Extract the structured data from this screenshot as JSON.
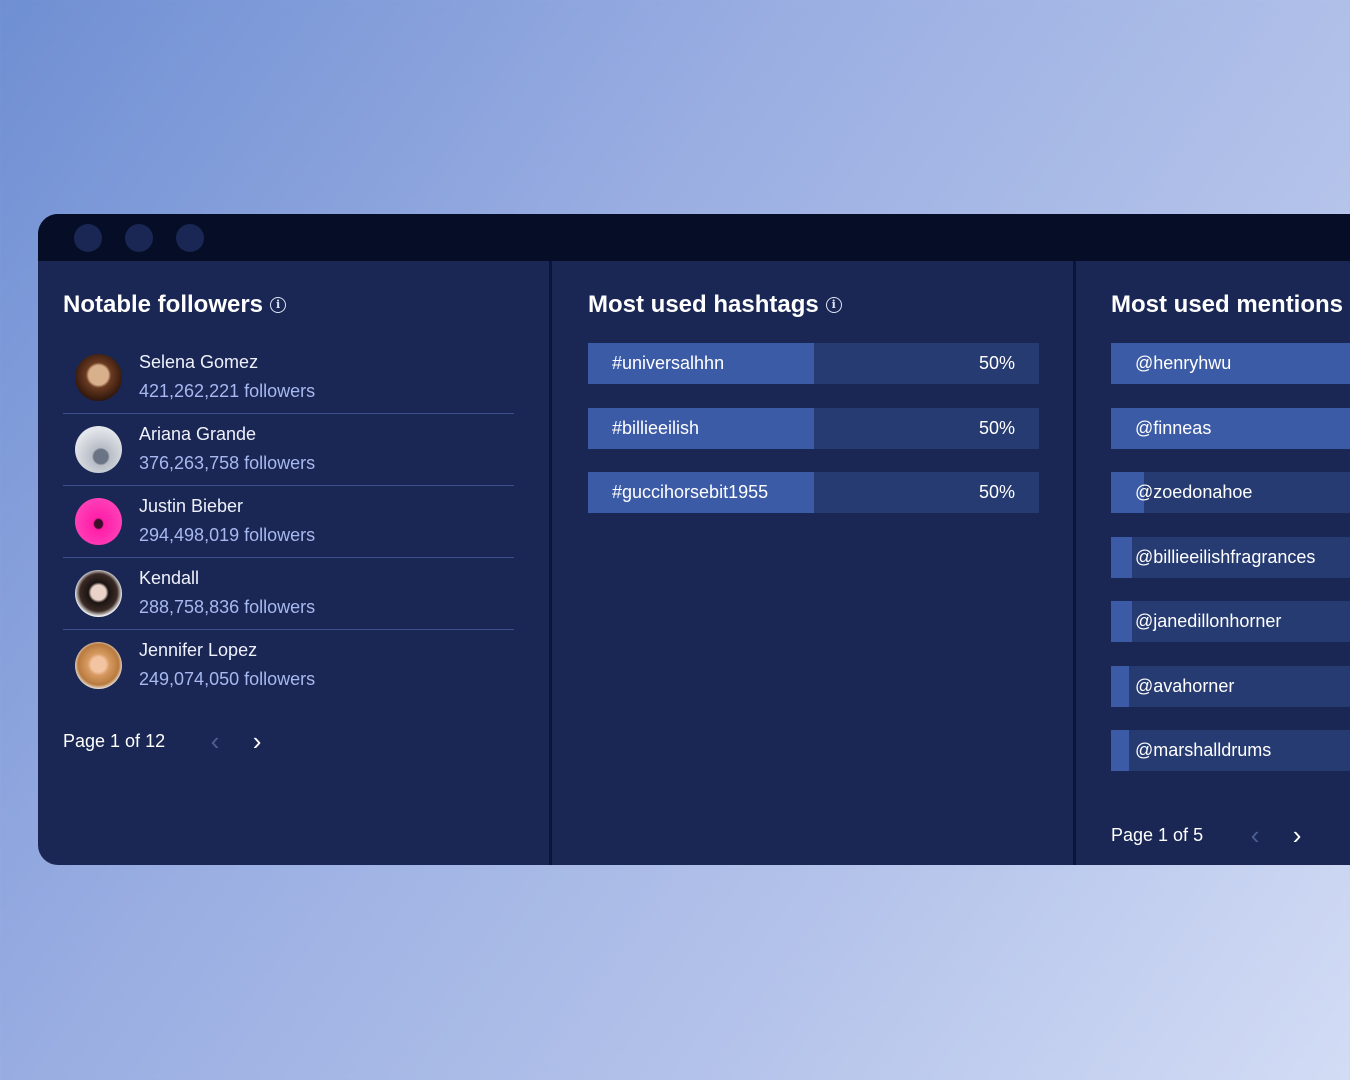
{
  "followers": {
    "title": "Notable followers",
    "items": [
      {
        "name": "Selena Gomez",
        "count": "421,262,221 followers"
      },
      {
        "name": "Ariana Grande",
        "count": "376,263,758 followers"
      },
      {
        "name": "Justin Bieber",
        "count": "294,498,019 followers"
      },
      {
        "name": "Kendall",
        "count": "288,758,836 followers"
      },
      {
        "name": "Jennifer Lopez",
        "count": "249,074,050 followers"
      }
    ],
    "pager": "Page 1 of 12"
  },
  "hashtags": {
    "title": "Most used hashtags",
    "items": [
      {
        "label": "#universalhhn",
        "value": "50%",
        "share": 0.5
      },
      {
        "label": "#billieeilish",
        "value": "50%",
        "share": 0.5
      },
      {
        "label": "#guccihorsebit1955",
        "value": "50%",
        "share": 0.5
      }
    ]
  },
  "mentions": {
    "title": "Most used mentions",
    "items": [
      {
        "label": "@henryhwu",
        "share": 1.0
      },
      {
        "label": "@finneas",
        "share": 1.0
      },
      {
        "label": "@zoedonahoe",
        "share": 0.11
      },
      {
        "label": "@billieeilishfragrances",
        "share": 0.07
      },
      {
        "label": "@janedillonhorner",
        "share": 0.07
      },
      {
        "label": "@avahorner",
        "share": 0.06
      },
      {
        "label": "@marshalldrums",
        "share": 0.06
      }
    ],
    "pager": "Page 1 of 5"
  },
  "icons": {
    "info": "info-icon",
    "prev": "chevron-left-icon",
    "next": "chevron-right-icon"
  },
  "colors": {
    "panel": "#1a2754",
    "titlebar": "#060e27",
    "bar_track": "#263b72",
    "bar_fill": "#3c5ba6",
    "follower_count": "#a6b8ef"
  }
}
